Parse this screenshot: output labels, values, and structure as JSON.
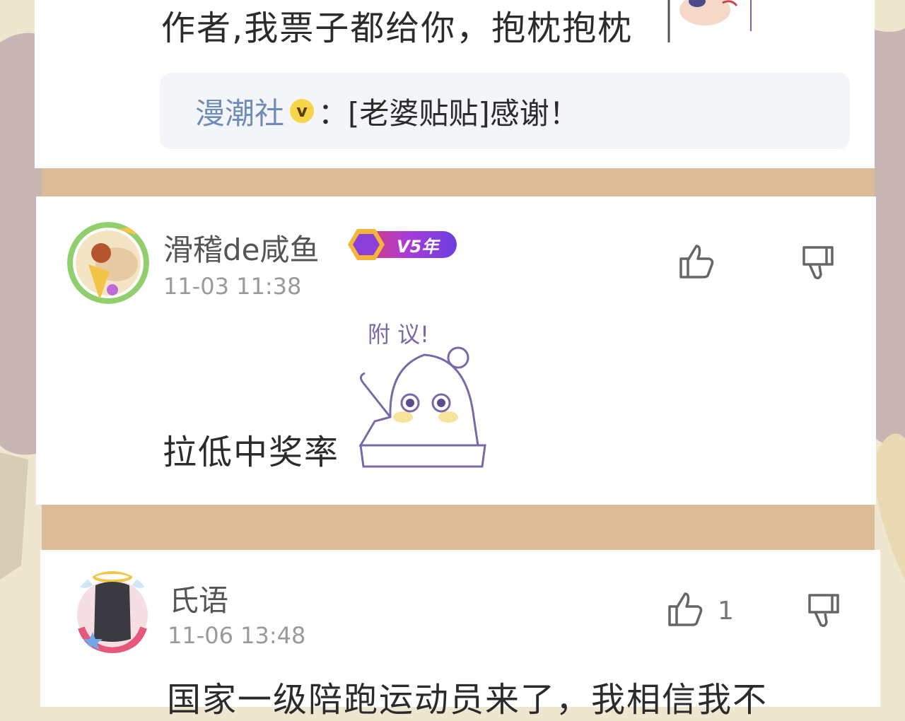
{
  "comments": [
    {
      "text": "作者,我票子都给你，抱枕抱枕",
      "reply": {
        "user": "漫潮社",
        "verified_badge": "v",
        "separator": "：",
        "content": "[老婆贴贴]感谢！"
      }
    },
    {
      "username": "滑稽de咸鱼",
      "level_badge": "V5年",
      "timestamp": "11-03 11:38",
      "text": "拉低中奖率",
      "sticker_text": "附 议!",
      "likes": ""
    },
    {
      "username": "氏语",
      "timestamp": "11-06 13:48",
      "text": "国家一级陪跑运动员来了，我相信我不",
      "likes": "1"
    }
  ],
  "icons": {
    "like": "thumbs-up-icon",
    "dislike": "thumbs-down-icon"
  },
  "colors": {
    "separator_strip": "#dcbc98",
    "reply_user": "#6d8db8",
    "level_badge_start": "#e13a6a",
    "level_badge_end": "#6b3ee0"
  }
}
